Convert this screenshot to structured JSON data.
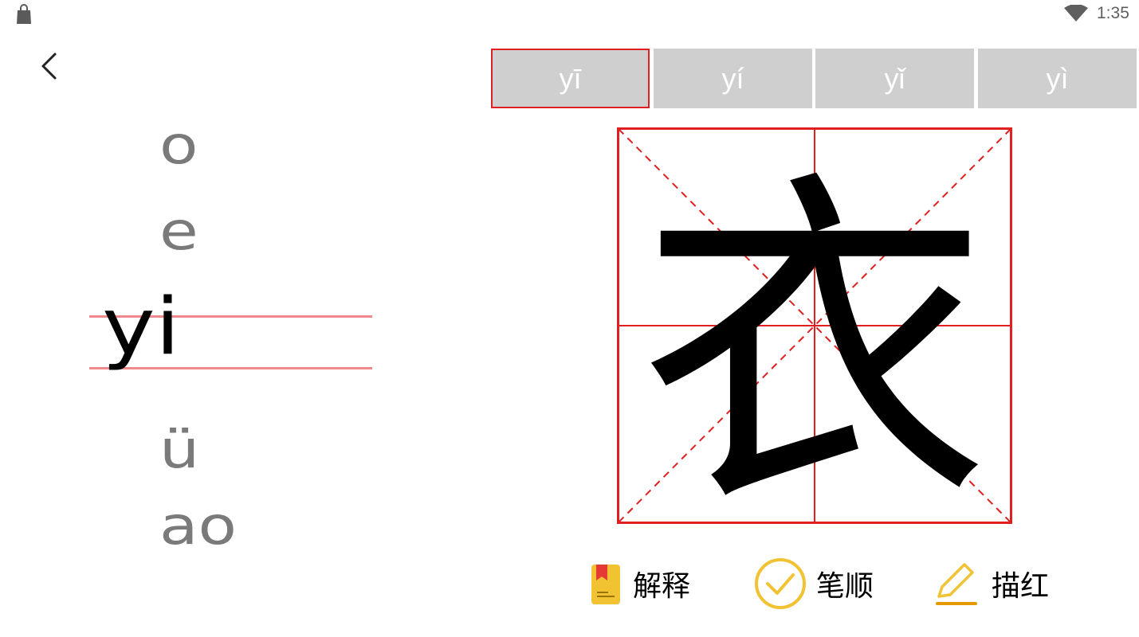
{
  "status_bar": {
    "time": "1:35"
  },
  "syllable_list": {
    "items": [
      "o",
      "e",
      "yi",
      "ü",
      "ao"
    ],
    "current": "yi"
  },
  "tone_tabs": {
    "tabs": [
      "yī",
      "yí",
      "yǐ",
      "yì"
    ],
    "active_index": 0
  },
  "character": {
    "glyph": "衣",
    "grid_color": "#e02020"
  },
  "actions": {
    "explain_label": "解释",
    "stroke_order_label": "笔顺",
    "trace_label": "描红"
  },
  "colors": {
    "active_border": "#e02020",
    "tab_bg": "#cfcfcf",
    "accent_yellow": "#f1c232",
    "guide_line": "#f08a8a"
  }
}
